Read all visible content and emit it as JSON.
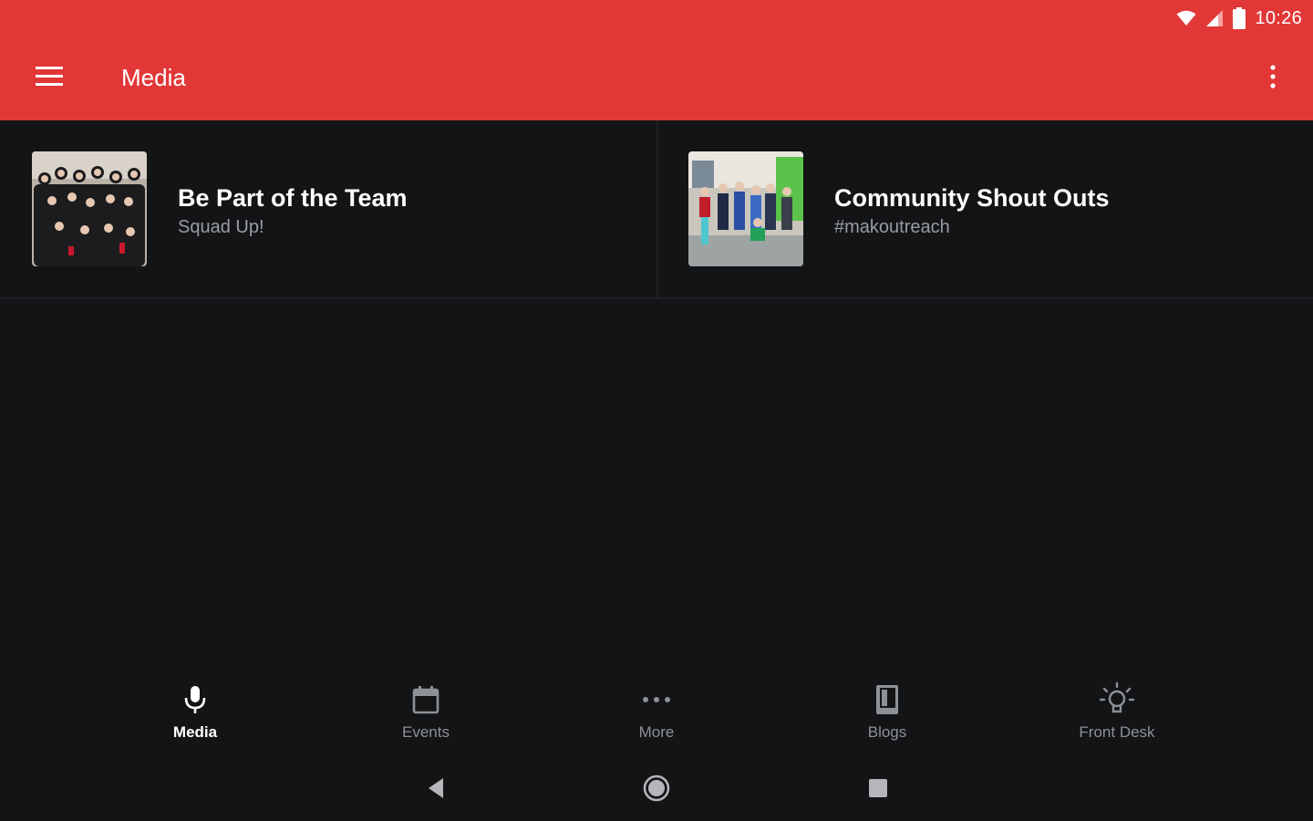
{
  "status_bar": {
    "time": "10:26",
    "icons": [
      "wifi-icon",
      "cellular-signal-icon",
      "battery-icon"
    ]
  },
  "app_bar": {
    "title": "Media",
    "menu_icon": "hamburger-menu-icon",
    "overflow_icon": "more-vertical-icon",
    "color": "#e23737"
  },
  "media_items": [
    {
      "title": "Be Part of the Team",
      "subtitle": "Squad Up!",
      "thumbnail": "group-photo-team"
    },
    {
      "title": "Community Shout Outs",
      "subtitle": "#makoutreach",
      "thumbnail": "group-photo-community"
    }
  ],
  "bottom_nav": {
    "items": [
      {
        "label": "Media",
        "icon": "microphone-icon",
        "active": true
      },
      {
        "label": "Events",
        "icon": "calendar-icon",
        "active": false
      },
      {
        "label": "More",
        "icon": "more-horizontal-icon",
        "active": false
      },
      {
        "label": "Blogs",
        "icon": "book-icon",
        "active": false
      },
      {
        "label": "Front Desk",
        "icon": "lightbulb-icon",
        "active": false
      }
    ]
  },
  "system_nav": {
    "buttons": [
      "back-icon",
      "home-icon",
      "recents-icon"
    ]
  },
  "colors": {
    "background": "#121416",
    "accent": "#e23737",
    "inactive_text": "#8e9196",
    "subtitle_text": "#9a9da2"
  }
}
